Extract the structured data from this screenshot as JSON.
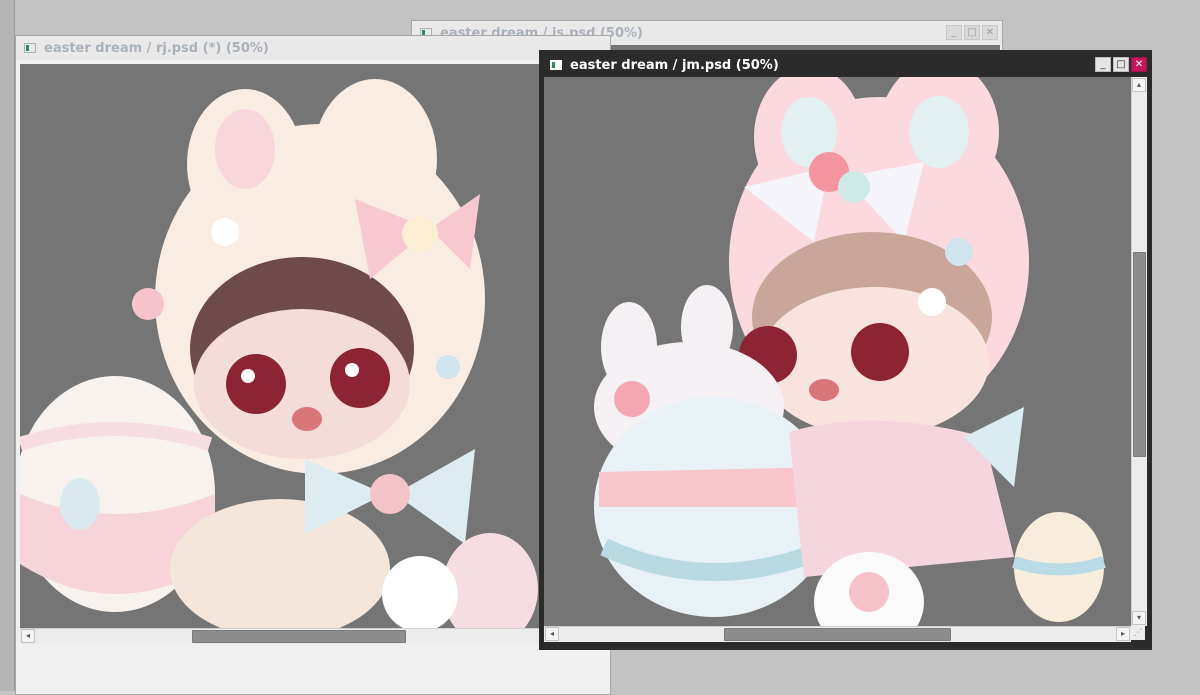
{
  "windows": {
    "js": {
      "title": "easter dream / js.psd (50%)",
      "icon": "document-icon",
      "controls": {
        "minimize": "_",
        "maximize": "□",
        "close": "✕"
      }
    },
    "rj": {
      "title": "easter dream / rj.psd (*) (50%)",
      "icon": "document-icon",
      "scroll": {
        "left": "◂",
        "right": "▸"
      }
    },
    "jm": {
      "title": "easter dream / jm.psd (50%)",
      "icon": "document-icon",
      "controls": {
        "minimize": "_",
        "maximize": "□",
        "close": "✕"
      },
      "scroll": {
        "up": "▴",
        "down": "▾",
        "left": "◂",
        "right": "▸"
      },
      "resize_grip": "⋰"
    }
  },
  "colors": {
    "canvas_gray": "#757575",
    "active_titlebar": "#2b2b2b",
    "close_button": "#c2185b",
    "inactive_title_text": "#aab1bb"
  }
}
